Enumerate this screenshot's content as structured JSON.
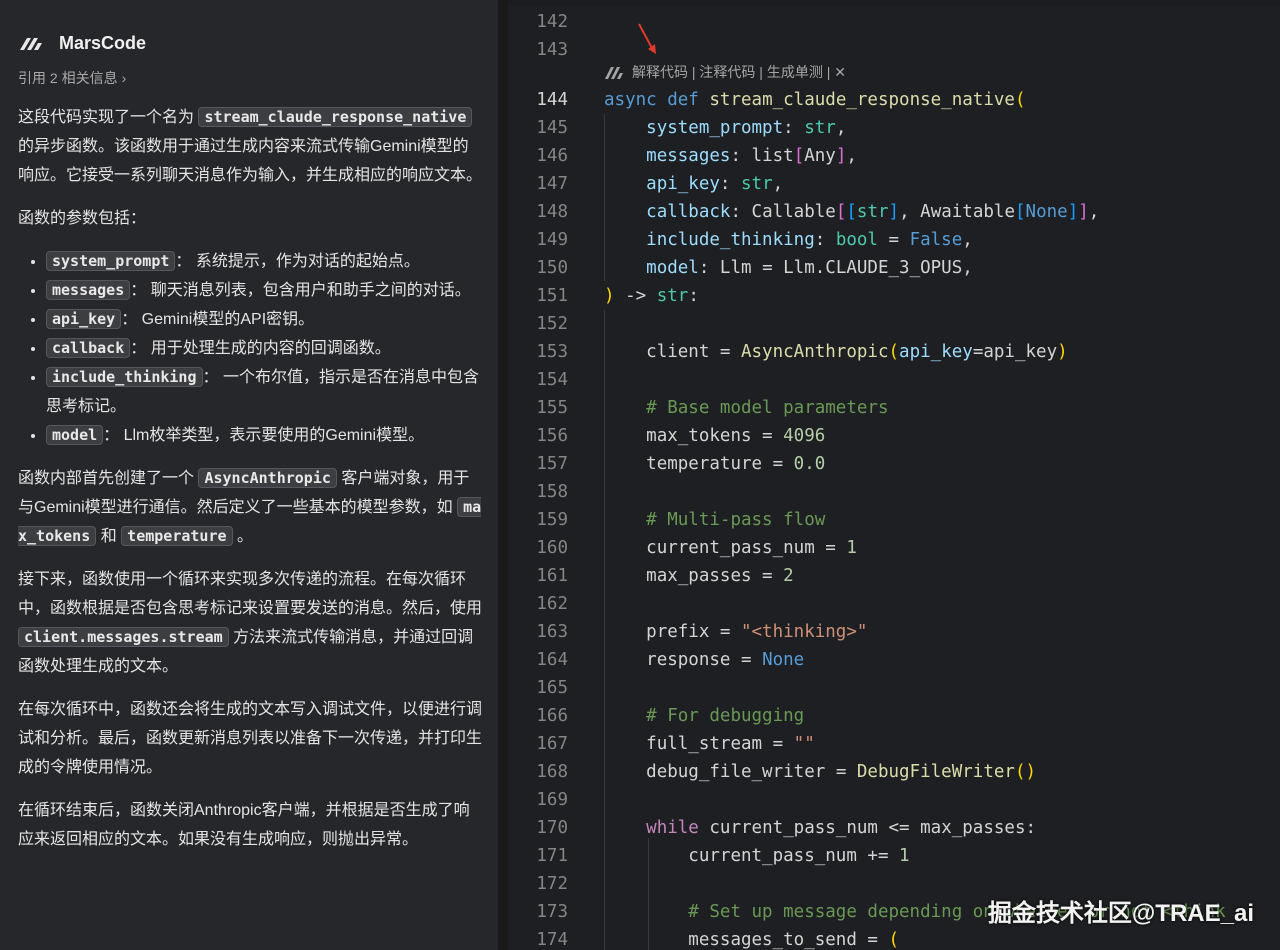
{
  "chat": {
    "brand": "MarsCode",
    "reference": "引用 2 相关信息",
    "intro": {
      "t1": "这段代码实现了一个名为",
      "c1": "stream_claude_response_native",
      "t2": "的异步函数。该函数用于通过生成内容来流式传输Gemini模型的响应。它接受一系列聊天消息作为输入，并生成相应的响应文本。"
    },
    "params_heading": "函数的参数包括：",
    "params": [
      {
        "code": "system_prompt",
        "desc": "： 系统提示，作为对话的起始点。"
      },
      {
        "code": "messages",
        "desc": "： 聊天消息列表，包含用户和助手之间的对话。"
      },
      {
        "code": "api_key",
        "desc": "： Gemini模型的API密钥。"
      },
      {
        "code": "callback",
        "desc": "： 用于处理生成的内容的回调函数。"
      },
      {
        "code": "include_thinking",
        "desc": "： 一个布尔值，指示是否在消息中包含思考标记。"
      },
      {
        "code": "model",
        "desc": "： Llm枚举类型，表示要使用的Gemini模型。"
      }
    ],
    "p3": {
      "t1": "函数内部首先创建了一个",
      "c1": "AsyncAnthropic",
      "t2": "客户端对象，用于与Gemini模型进行通信。然后定义了一些基本的模型参数，如",
      "c2": "max_tokens",
      "t3": "和",
      "c3": "temperature",
      "t4": "。"
    },
    "p4": {
      "t1": "接下来，函数使用一个循环来实现多次传递的流程。在每次循环中，函数根据是否包含思考标记来设置要发送的消息。然后，使用",
      "c1": "client.messages.stream",
      "t2": "方法来流式传输消息，并通过回调函数处理生成的文本。"
    },
    "p5": "在每次循环中，函数还会将生成的文本写入调试文件，以便进行调试和分析。最后，函数更新消息列表以准备下一次传递，并打印生成的令牌使用情况。",
    "p6": "在循环结束后，函数关闭Anthropic客户端，并根据是否生成了响应来返回相应的文本。如果没有生成响应，则抛出异常。"
  },
  "editor": {
    "codelens": {
      "explain": "解释代码",
      "sep": " | ",
      "comment": "注释代码",
      "test": "生成单测",
      "close": "✕"
    },
    "watermark": "掘金技术社区@TRAE_ai",
    "lines": [
      {
        "n": "142"
      },
      {
        "n": "143"
      },
      {
        "n": "144",
        "current": true
      },
      {
        "n": "145"
      },
      {
        "n": "146"
      },
      {
        "n": "147"
      },
      {
        "n": "148"
      },
      {
        "n": "149"
      },
      {
        "n": "150"
      },
      {
        "n": "151"
      },
      {
        "n": "152"
      },
      {
        "n": "153"
      },
      {
        "n": "154"
      },
      {
        "n": "155"
      },
      {
        "n": "156"
      },
      {
        "n": "157"
      },
      {
        "n": "158"
      },
      {
        "n": "159"
      },
      {
        "n": "160"
      },
      {
        "n": "161"
      },
      {
        "n": "162"
      },
      {
        "n": "163"
      },
      {
        "n": "164"
      },
      {
        "n": "165"
      },
      {
        "n": "166"
      },
      {
        "n": "167"
      },
      {
        "n": "168"
      },
      {
        "n": "169"
      },
      {
        "n": "170"
      },
      {
        "n": "171"
      },
      {
        "n": "172"
      },
      {
        "n": "173"
      },
      {
        "n": "174"
      }
    ],
    "tok": {
      "async": "async",
      "def": "def",
      "fname": "stream_claude_response_native",
      "system_prompt": "system_prompt",
      "messages": "messages",
      "api_key": "api_key",
      "callback": "callback",
      "include_thinking": "include_thinking",
      "model": "model",
      "str": "str",
      "list": "list",
      "Any": "Any",
      "Callable": "Callable",
      "Awaitable": "Awaitable",
      "None": "None",
      "bool": "bool",
      "False": "False",
      "Llm": "Llm",
      "LlmOpus": "Llm.CLAUDE_3_OPUS",
      "client": "client",
      "AsyncAnthropic": "AsyncAnthropic",
      "c155": "# Base model parameters",
      "max_tokens": "max_tokens",
      "n4096": "4096",
      "temperature": "temperature",
      "n00": "0.0",
      "c159": "# Multi-pass flow",
      "current_pass_num": "current_pass_num",
      "n1": "1",
      "max_passes": "max_passes",
      "n2": "2",
      "prefix": "prefix",
      "s_thinking": "\"<thinking>\"",
      "response": "response",
      "c166": "# For debugging",
      "full_stream": "full_stream",
      "s_empty": "\"\"",
      "debug_file_writer": "debug_file_writer",
      "DebugFileWriter": "DebugFileWriter",
      "while": "while",
      "c173": "# Set up message depending on whether or not <think",
      "messages_to_send": "messages_to_send"
    }
  }
}
